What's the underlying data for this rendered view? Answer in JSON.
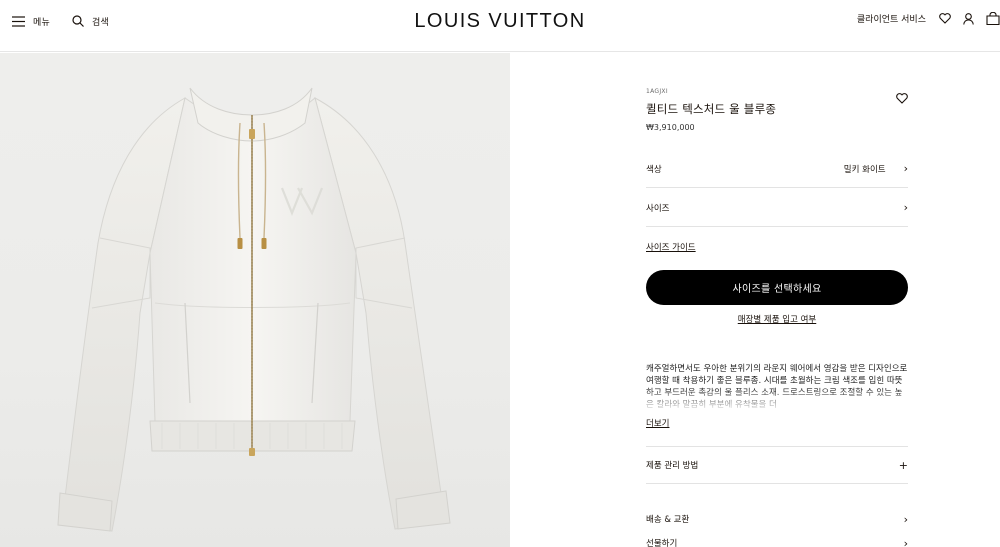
{
  "header": {
    "menu_label": "메뉴",
    "search_label": "검색",
    "logo": "LOUIS VUITTON",
    "client_service": "클라이언트 서비스"
  },
  "product": {
    "sku": "1AGJXI",
    "title": "퀼티드 텍스처드 울 블루종",
    "price": "₩3,910,000",
    "color_label": "색상",
    "color_value": "밀키 화이트",
    "size_label": "사이즈",
    "size_guide": "사이즈 가이드",
    "cta": "사이즈를 선택하세요",
    "stock_check": "매장별 제품 입고 여부",
    "description": "캐주얼하면서도 우아한 분위기의 라운지 웨어에서 영감을 받은 디자인으로 여행할 때 착용하기 좋은 블루종. 시대를 초월하는 크림 색조를 입힌 따뜻하고 부드러운 촉감의 울 플리스 소재. 드로스트링으로 조절할 수 있는 높은 칼라와 말끔히 부분에 유착물을 더",
    "read_more": "더보기",
    "care_label": "제품 관리 방법",
    "care_toggle": "+",
    "shipping_label": "배송 & 교환",
    "gift_label": "선물하기"
  },
  "colors": {
    "primary": "#000000",
    "background": "#ffffff",
    "image_bg": "#ececea",
    "divider": "#e3e3e3"
  }
}
